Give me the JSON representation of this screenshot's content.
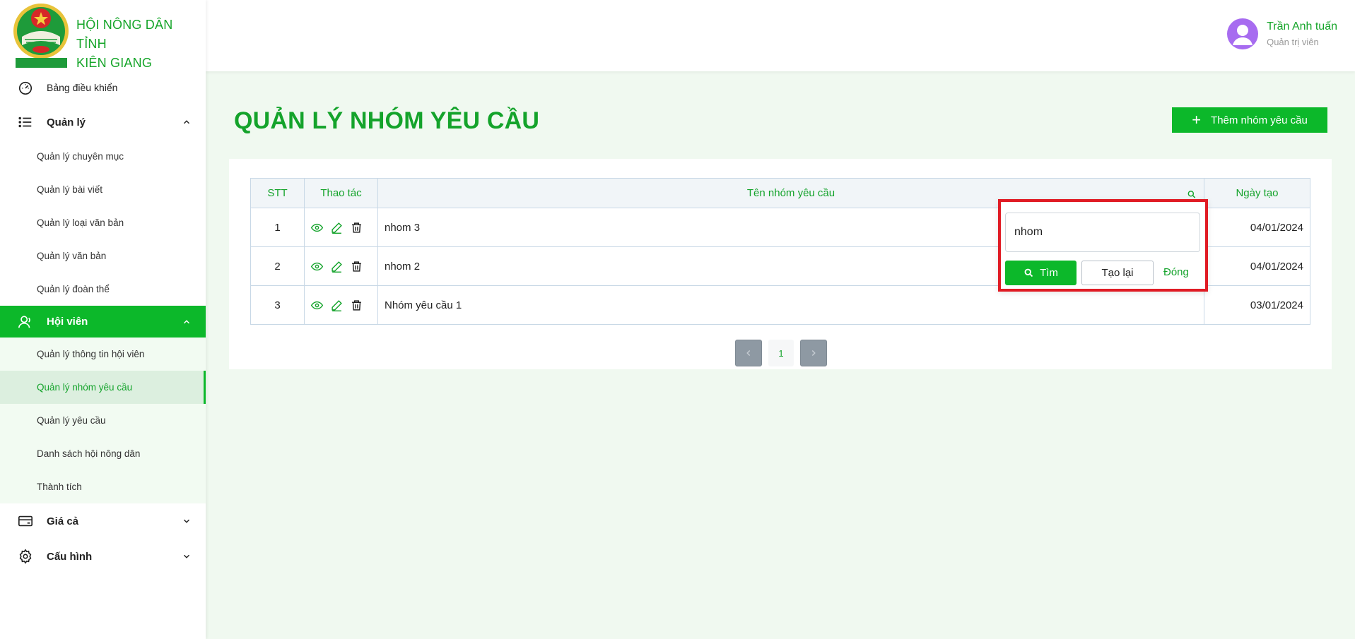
{
  "brand": {
    "title_line1": "HỘI NÔNG DÂN TỈNH",
    "title_line2": "KIÊN GIANG",
    "logo_text": "HỘI NÔNG DÂN TỈNH KIÊN GIANG"
  },
  "sidebar": {
    "dashboard": "Bảng điều khiển",
    "management": {
      "label": "Quản lý",
      "items": [
        "Quản lý chuyên mục",
        "Quản lý bài viết",
        "Quản lý loại văn bản",
        "Quản lý văn bản",
        "Quản lý đoàn thể"
      ]
    },
    "members": {
      "label": "Hội viên",
      "items": [
        "Quản lý thông tin hội viên",
        "Quản lý nhóm yêu cầu",
        "Quản lý yêu cầu",
        "Danh sách hội nông dân",
        "Thành tích"
      ],
      "active_item": "Quản lý nhóm yêu cầu"
    },
    "prices": "Giá cả",
    "config": "Cấu hình"
  },
  "user": {
    "name": "Trần Anh tuấn",
    "role": "Quản trị viên"
  },
  "page": {
    "title": "QUẢN LÝ NHÓM YÊU CẦU",
    "add_button": "Thêm nhóm yêu cầu"
  },
  "table": {
    "headers": {
      "stt": "STT",
      "actions": "Thao tác",
      "name": "Tên nhóm yêu cầu",
      "date": "Ngày tạo"
    },
    "rows": [
      {
        "stt": "1",
        "name": "nhom 3",
        "date": "04/01/2024"
      },
      {
        "stt": "2",
        "name": "nhom 2",
        "date": "04/01/2024"
      },
      {
        "stt": "3",
        "name": "Nhóm yêu cầu 1",
        "date": "03/01/2024"
      }
    ]
  },
  "pagination": {
    "current": "1"
  },
  "filter": {
    "value": "nhom",
    "find_label": "Tìm",
    "reset_label": "Tạo lại",
    "close_label": "Đóng"
  },
  "colors": {
    "accent": "#0cb82a",
    "accent_text": "#14a32b",
    "highlight_border": "#e01b24",
    "avatar": "#a76cf0"
  }
}
